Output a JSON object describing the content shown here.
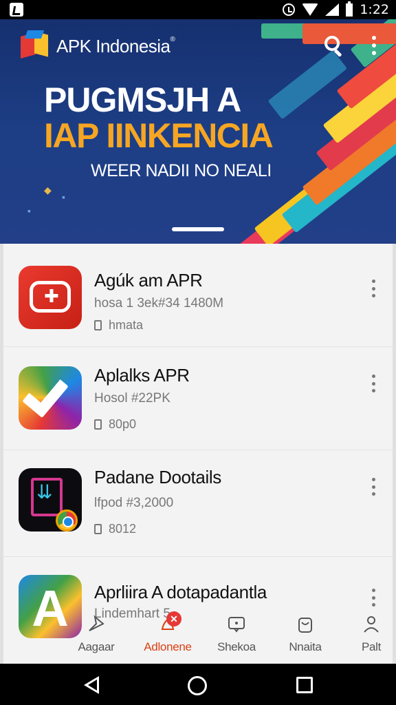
{
  "status_bar": {
    "time": "1:22",
    "icons": [
      "notification-icon",
      "alarm-icon",
      "wifi-icon",
      "signal-icon",
      "battery-icon"
    ]
  },
  "header": {
    "app_title": "APK Indonesia",
    "title_mark": "®",
    "icons": [
      "logo-icon",
      "search-icon",
      "more-vert-icon"
    ]
  },
  "banner": {
    "headline_1": "PUGMSJH A",
    "headline_2": "IAP IINKENCIA",
    "subline": "WEER NADII NO NEALI",
    "colors": {
      "background": "#1d3e85",
      "headline_2": "#f6a623"
    }
  },
  "apps": [
    {
      "title": "Agúk am APR",
      "subtitle": "hosa 1 3ek#34 1480M",
      "meta": "hmata",
      "icon": "red-gamepad-icon"
    },
    {
      "title": "Aplalks APR",
      "subtitle": "Hosol #22PK",
      "meta": "80p0",
      "icon": "checkmark-icon"
    },
    {
      "title": "Padane Dootails",
      "subtitle": "lfpod #3,2000",
      "meta": "8012",
      "icon": "download-doc-icon"
    },
    {
      "title": "Aprliira A dotapadantla",
      "subtitle": "Lindemhart 5",
      "meta": "",
      "icon": "letter-a-icon"
    }
  ],
  "bottom_nav": {
    "tabs": [
      {
        "label": "Aagaar",
        "icon": "send-icon",
        "active": false
      },
      {
        "label": "Adlonene",
        "icon": "bell-icon",
        "active": true,
        "badge": "✕"
      },
      {
        "label": "Shekoa",
        "icon": "chat-icon",
        "active": false
      },
      {
        "label": "Nnaita",
        "icon": "bag-icon",
        "active": false
      },
      {
        "label": "Palt",
        "icon": "person-icon",
        "active": false
      }
    ],
    "colors": {
      "active": "#d84315",
      "inactive": "#555555"
    }
  },
  "system_nav": {
    "icons": [
      "back-icon",
      "home-icon",
      "recents-icon"
    ]
  }
}
